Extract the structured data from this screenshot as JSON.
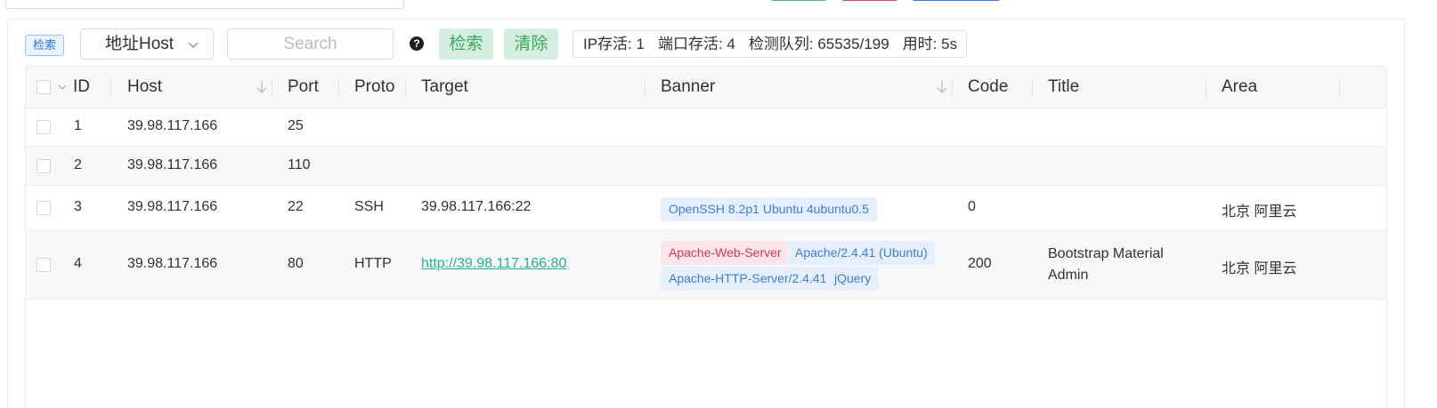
{
  "toolbar": {
    "tag_label": "检索",
    "select_value": "地址Host",
    "search_placeholder": "Search",
    "help_symbol": "?",
    "search_button": "检索",
    "clear_button": "清除",
    "stats": {
      "ip_alive": "IP存活: 1",
      "port_alive": "端口存活: 4",
      "queue": "检测队列: 65535/199",
      "elapsed": "用时: 5s"
    }
  },
  "table": {
    "headers": {
      "id": "ID",
      "host": "Host",
      "port": "Port",
      "proto": "Proto",
      "target": "Target",
      "banner": "Banner",
      "code": "Code",
      "title": "Title",
      "area": "Area"
    },
    "rows": [
      {
        "id": "1",
        "host": "39.98.117.166",
        "port": "25",
        "proto": "",
        "target": "",
        "banners": [],
        "code": "",
        "title": "",
        "area": ""
      },
      {
        "id": "2",
        "host": "39.98.117.166",
        "port": "110",
        "proto": "",
        "target": "",
        "banners": [],
        "code": "",
        "title": "",
        "area": ""
      },
      {
        "id": "3",
        "host": "39.98.117.166",
        "port": "22",
        "proto": "SSH",
        "target": "39.98.117.166:22",
        "banners": [
          {
            "text": "OpenSSH 8.2p1 Ubuntu 4ubuntu0.5",
            "color": "blue"
          }
        ],
        "code": "0",
        "title": "",
        "area": "北京 阿里云"
      },
      {
        "id": "4",
        "host": "39.98.117.166",
        "port": "80",
        "proto": "HTTP",
        "target": "http://39.98.117.166:80",
        "banners": [
          {
            "text": "Apache-Web-Server",
            "color": "red"
          },
          {
            "text": "Apache/2.4.41 (Ubuntu)",
            "color": "blue"
          },
          {
            "text": "Apache-HTTP-Server/2.4.41",
            "color": "blue"
          },
          {
            "text": "jQuery",
            "color": "blue"
          }
        ],
        "code": "200",
        "title_line1": "Bootstrap Material",
        "title_line2": "Admin",
        "area": "北京 阿里云"
      }
    ]
  },
  "colors": {
    "accent_green": "#38a865",
    "link": "#21b199",
    "badge_blue": "#3f7fd0",
    "badge_red": "#cf3c50"
  }
}
